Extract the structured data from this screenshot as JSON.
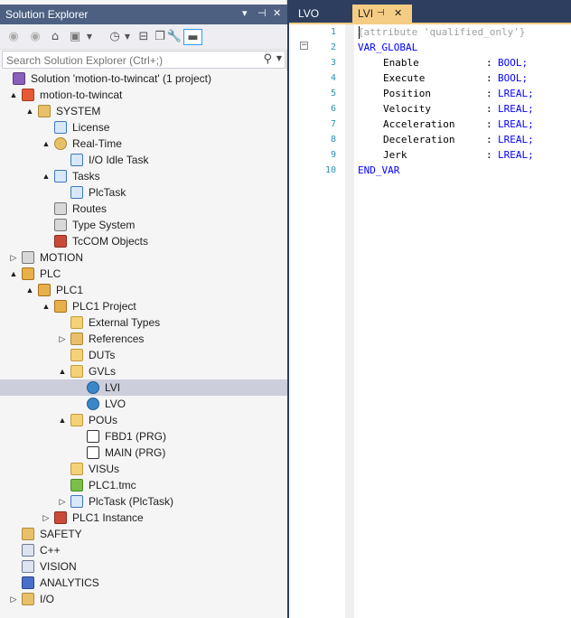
{
  "explorer": {
    "title": "Solution Explorer",
    "search_placeholder": "Search Solution Explorer (Ctrl+;)",
    "tree": [
      {
        "label": "Solution 'motion-to-twincat' (1 project)",
        "icon": "solution-icon",
        "arrow": ""
      },
      {
        "label": "motion-to-twincat",
        "icon": "twincat-project-icon",
        "arrow": "▲"
      },
      {
        "label": "SYSTEM",
        "icon": "system-icon",
        "arrow": "▲"
      },
      {
        "label": "License",
        "icon": "license-icon",
        "arrow": ""
      },
      {
        "label": "Real-Time",
        "icon": "realtime-icon",
        "arrow": "▲"
      },
      {
        "label": "I/O Idle Task",
        "icon": "task-icon",
        "arrow": ""
      },
      {
        "label": "Tasks",
        "icon": "tasks-icon",
        "arrow": "▲"
      },
      {
        "label": "PlcTask",
        "icon": "task-icon",
        "arrow": ""
      },
      {
        "label": "Routes",
        "icon": "routes-icon",
        "arrow": ""
      },
      {
        "label": "Type System",
        "icon": "type-system-icon",
        "arrow": ""
      },
      {
        "label": "TcCOM Objects",
        "icon": "tccom-icon",
        "arrow": ""
      },
      {
        "label": "MOTION",
        "icon": "motion-icon",
        "arrow": "▷"
      },
      {
        "label": "PLC",
        "icon": "plc-icon",
        "arrow": "▲"
      },
      {
        "label": "PLC1",
        "icon": "plc-project-icon",
        "arrow": "▲"
      },
      {
        "label": "PLC1 Project",
        "icon": "plc-project-file-icon",
        "arrow": "▲"
      },
      {
        "label": "External Types",
        "icon": "folder-icon",
        "arrow": ""
      },
      {
        "label": "References",
        "icon": "references-icon",
        "arrow": "▷"
      },
      {
        "label": "DUTs",
        "icon": "folder-icon",
        "arrow": ""
      },
      {
        "label": "GVLs",
        "icon": "folder-open-icon",
        "arrow": "▲"
      },
      {
        "label": "LVI",
        "icon": "gvl-icon",
        "arrow": ""
      },
      {
        "label": "LVO",
        "icon": "gvl-icon",
        "arrow": ""
      },
      {
        "label": "POUs",
        "icon": "folder-open-icon",
        "arrow": "▲"
      },
      {
        "label": "FBD1 (PRG)",
        "icon": "pou-icon",
        "arrow": ""
      },
      {
        "label": "MAIN (PRG)",
        "icon": "pou-icon",
        "arrow": ""
      },
      {
        "label": "VISUs",
        "icon": "folder-icon",
        "arrow": ""
      },
      {
        "label": "PLC1.tmc",
        "icon": "tmc-icon",
        "arrow": ""
      },
      {
        "label": "PlcTask (PlcTask)",
        "icon": "task-icon",
        "arrow": "▷"
      },
      {
        "label": "PLC1 Instance",
        "icon": "instance-icon",
        "arrow": "▷"
      },
      {
        "label": "SAFETY",
        "icon": "safety-icon",
        "arrow": ""
      },
      {
        "label": "C++",
        "icon": "cpp-icon",
        "arrow": ""
      },
      {
        "label": "VISION",
        "icon": "vision-icon",
        "arrow": ""
      },
      {
        "label": "ANALYTICS",
        "icon": "analytics-icon",
        "arrow": ""
      },
      {
        "label": "I/O",
        "icon": "io-icon",
        "arrow": "▷"
      }
    ]
  },
  "editor": {
    "tabs": [
      {
        "label": "LVO"
      },
      {
        "label": "LVI"
      }
    ],
    "lines": [
      {
        "num": "1",
        "text": "{attribute 'qualified_only'}"
      },
      {
        "num": "2",
        "text": "VAR_GLOBAL"
      },
      {
        "num": "3",
        "name": "Enable",
        "type": "BOOL;"
      },
      {
        "num": "4",
        "name": "Execute",
        "type": "BOOL;"
      },
      {
        "num": "5",
        "name": "Position",
        "type": "LREAL;"
      },
      {
        "num": "6",
        "name": "Velocity",
        "type": "LREAL;"
      },
      {
        "num": "7",
        "name": "Acceleration",
        "type": "LREAL;"
      },
      {
        "num": "8",
        "name": "Deceleration",
        "type": "LREAL;"
      },
      {
        "num": "9",
        "name": "Jerk",
        "type": "LREAL;"
      },
      {
        "num": "10",
        "text": "END_VAR"
      }
    ],
    "colon": ":"
  },
  "colors": {
    "accent": "#f5cc84",
    "title_bar": "#4d6082",
    "selection": "#cccedb",
    "keyword": "#0000ff"
  }
}
